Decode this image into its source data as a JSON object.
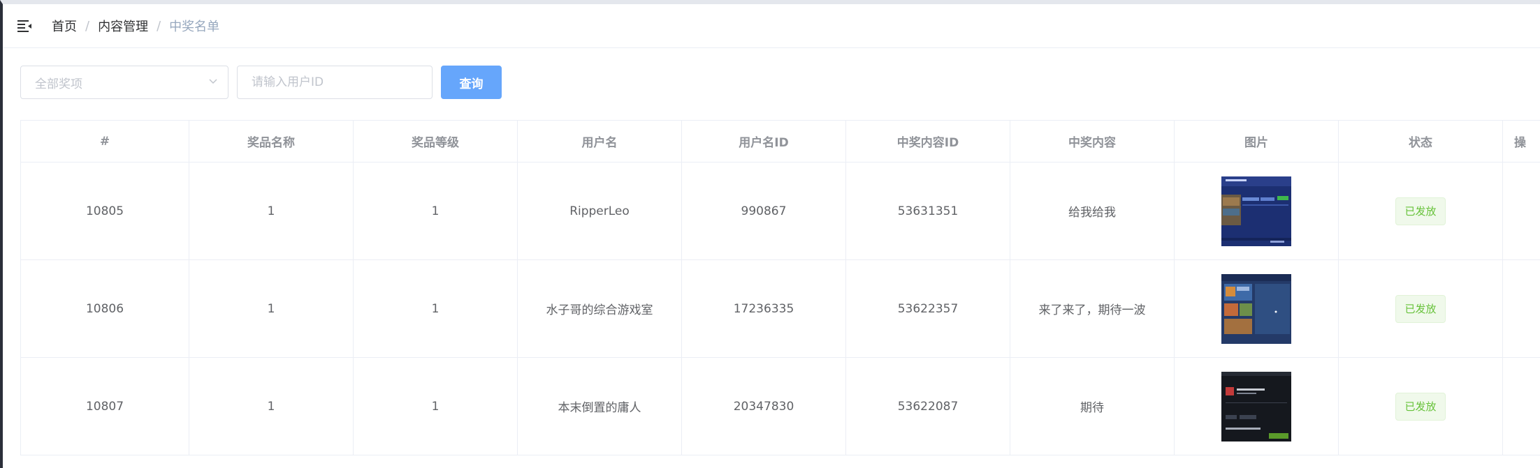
{
  "header": {
    "breadcrumbs": [
      "首页",
      "内容管理",
      "中奖名单"
    ],
    "separator": "/"
  },
  "filters": {
    "prize_select_placeholder": "全部奖项",
    "user_id_placeholder": "请输入用户ID",
    "query_button": "查询"
  },
  "table": {
    "columns": [
      "#",
      "奖品名称",
      "奖品等级",
      "用户名",
      "用户名ID",
      "中奖内容ID",
      "中奖内容",
      "图片",
      "状态",
      "操"
    ],
    "rows": [
      {
        "id": "10805",
        "prize_name": "1",
        "prize_level": "1",
        "username": "RipperLeo",
        "user_id": "990867",
        "content_id": "53631351",
        "content": "给我给我",
        "status": "已发放"
      },
      {
        "id": "10806",
        "prize_name": "1",
        "prize_level": "1",
        "username": "水子哥的综合游戏室",
        "user_id": "17236335",
        "content_id": "53622357",
        "content": "来了来了，期待一波",
        "status": "已发放"
      },
      {
        "id": "10807",
        "prize_name": "1",
        "prize_level": "1",
        "username": "本末倒置的庸人",
        "user_id": "20347830",
        "content_id": "53622087",
        "content": "期待",
        "status": "已发放"
      }
    ]
  },
  "colors": {
    "primary_button": "#66a6fb",
    "status_success": "#67c23a",
    "sidebar_edge": "#2b2f3a"
  }
}
